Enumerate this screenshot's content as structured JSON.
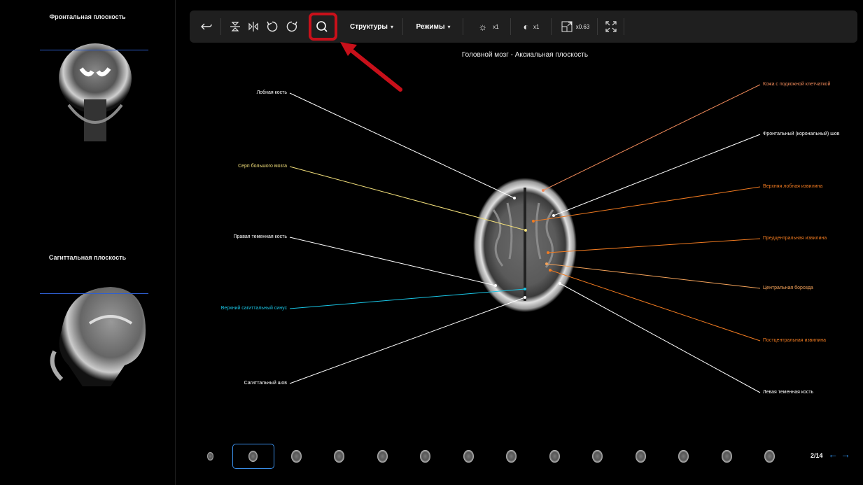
{
  "sidebar": {
    "frontal_title": "Фронтальная плоскость",
    "sagittal_title": "Сагиттальная плоскость"
  },
  "toolbar": {
    "undo_icon": "undo-icon",
    "flip_vertical_icon": "flip-vertical-icon",
    "flip_horizontal_icon": "flip-horizontal-icon",
    "rotate_left_icon": "rotate-left-icon",
    "rotate_right_icon": "rotate-right-icon",
    "search_icon": "search-icon",
    "structures_label": "Структуры",
    "modes_label": "Режимы",
    "brightness_value": "x1",
    "contrast_value": "x1",
    "zoom_value": "x0.63",
    "highlight_color": "#c8101a"
  },
  "viewer": {
    "title": "Головной мозг - Аксиальная плоскость"
  },
  "labels_left": [
    {
      "text": "Лобная кость",
      "color": "#ffffff"
    },
    {
      "text": "Серп большого мозга",
      "color": "#f2df7a"
    },
    {
      "text": "Правая теменная кость",
      "color": "#ffffff"
    },
    {
      "text": "Верхний сагиттальный синус",
      "color": "#19c6e6"
    },
    {
      "text": "Сагиттальный шов",
      "color": "#ffffff"
    }
  ],
  "labels_right": [
    {
      "text": "Кожа с подкожной клетчаткой",
      "color": "#f08a5a"
    },
    {
      "text": "Фронтальный (корональный) шов",
      "color": "#ffffff"
    },
    {
      "text": "Верхняя лобная извилина",
      "color": "#f07a20"
    },
    {
      "text": "Предцентральная извилина",
      "color": "#f07a20"
    },
    {
      "text": "Центральная борозда",
      "color": "#f5a35a"
    },
    {
      "text": "Постцентральная извилина",
      "color": "#f07a20"
    },
    {
      "text": "Левая теменная кость",
      "color": "#ffffff"
    }
  ],
  "strip": {
    "count": 14,
    "active_index": 1,
    "page": "2/14",
    "prev_arrow": "←",
    "next_arrow": "→",
    "accent": "#2f8fe8"
  }
}
